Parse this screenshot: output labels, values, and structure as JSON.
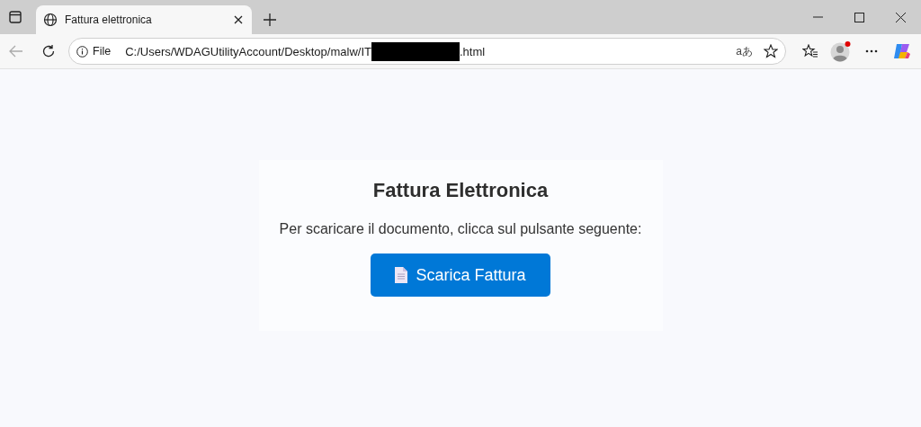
{
  "tab": {
    "title": "Fattura elettronica",
    "selected": true
  },
  "address_bar": {
    "scheme_label": "File",
    "url_start": "C:/Users/WDAGUtilityAccount/Desktop/malw/IT",
    "url_end": ".html",
    "translate_icon": "aあ"
  },
  "page": {
    "heading": "Fattura Elettronica",
    "text": "Per scaricare il documento, clicca sul pulsante seguente:",
    "button": "Scarica Fattura"
  }
}
